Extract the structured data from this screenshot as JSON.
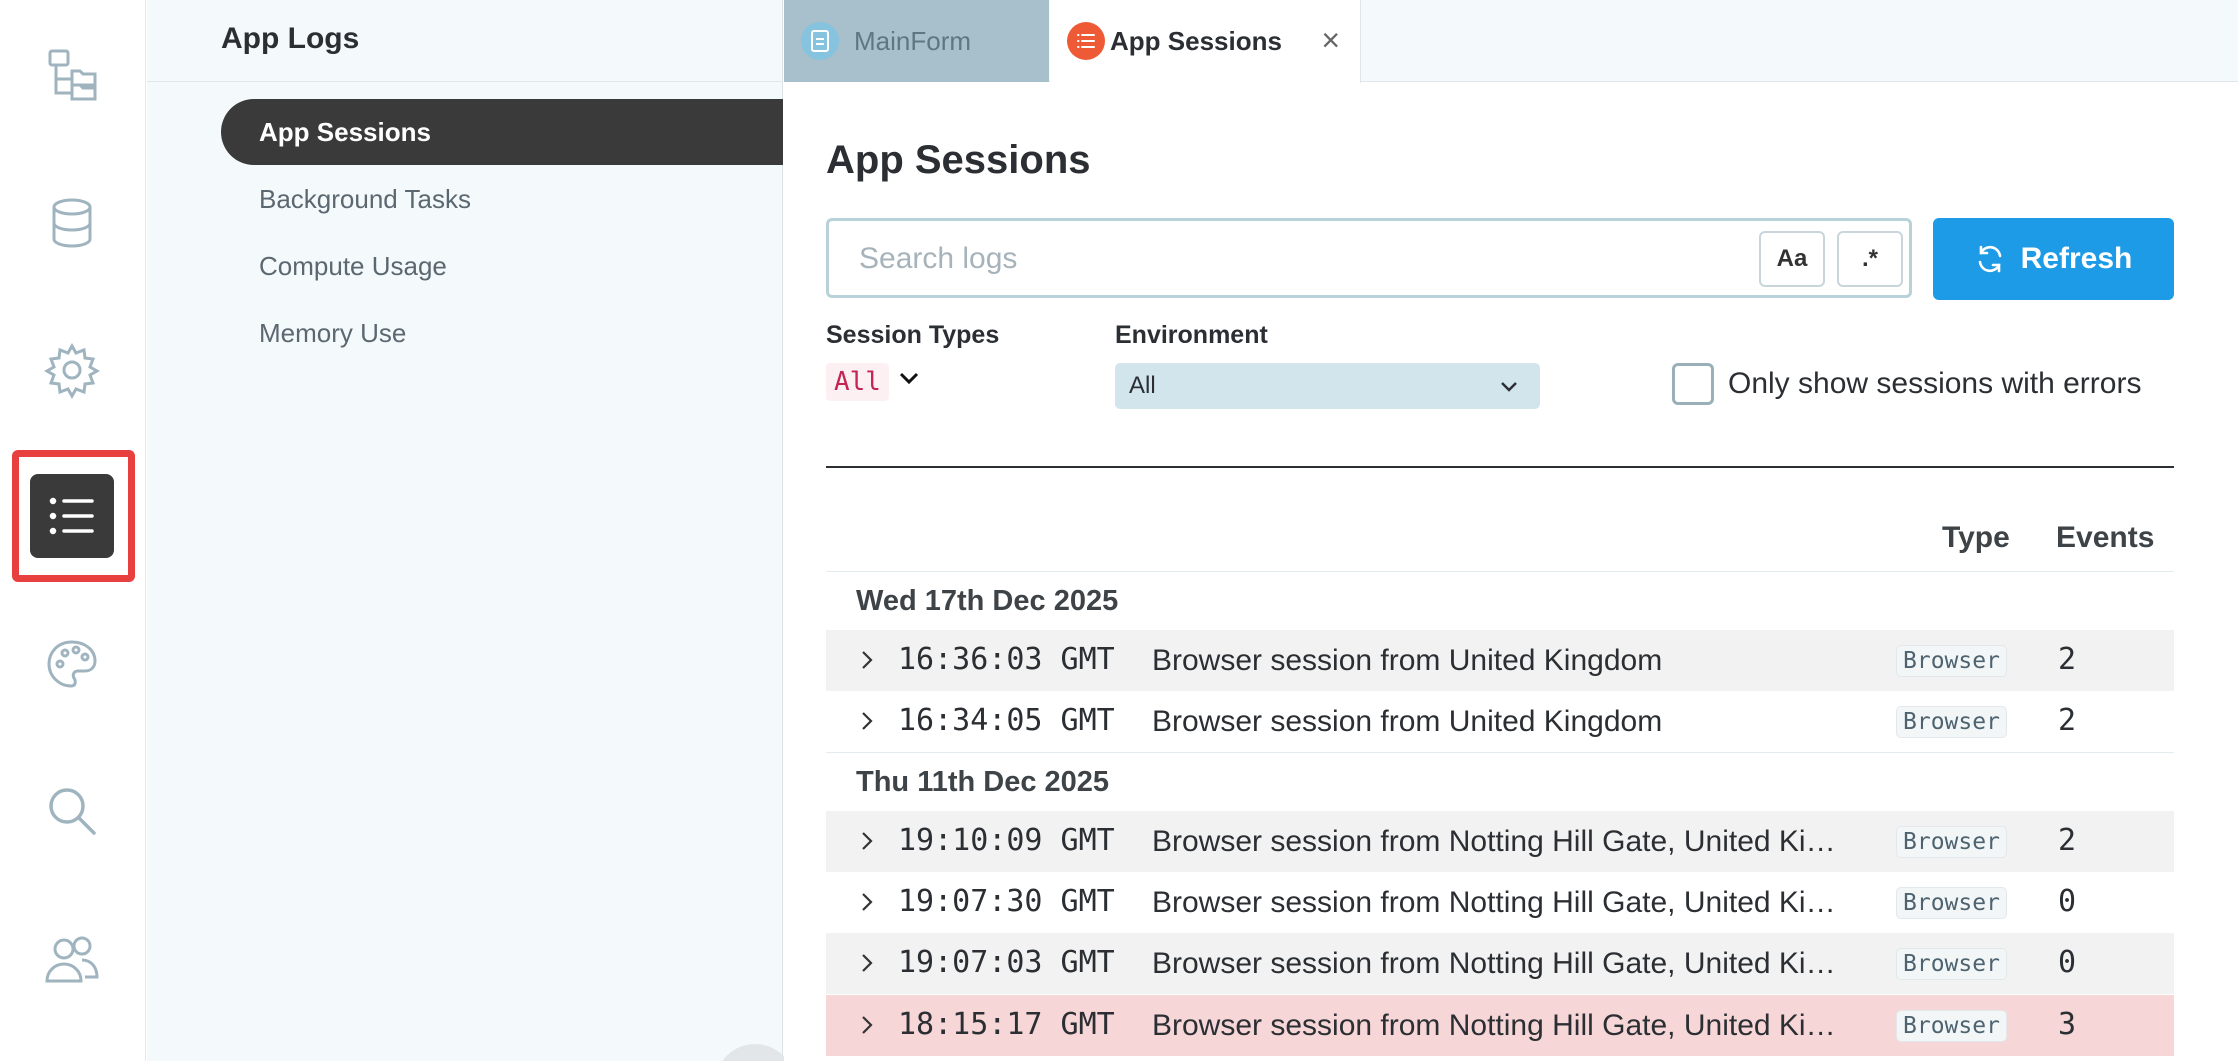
{
  "rail": {
    "items": [
      {
        "name": "tree-view-icon"
      },
      {
        "name": "database-icon"
      },
      {
        "name": "settings-gear-icon"
      },
      {
        "name": "list-icon",
        "active": true
      },
      {
        "name": "palette-icon"
      },
      {
        "name": "search-icon"
      },
      {
        "name": "users-icon"
      }
    ]
  },
  "panel": {
    "title": "App Logs",
    "items": [
      {
        "label": "App Sessions",
        "active": true
      },
      {
        "label": "Background Tasks"
      },
      {
        "label": "Compute Usage"
      },
      {
        "label": "Memory Use"
      }
    ]
  },
  "tabs": [
    {
      "label": "MainForm",
      "icon": "form-icon",
      "active": false
    },
    {
      "label": "App Sessions",
      "icon": "list-icon",
      "active": true,
      "close": "×"
    }
  ],
  "main": {
    "title": "App Sessions",
    "search": {
      "placeholder": "Search logs",
      "value": "",
      "case_toggle": "Aa",
      "regex_toggle": ".*"
    },
    "refresh_label": "Refresh",
    "filters": {
      "session_types_label": "Session Types",
      "session_types_value": "All",
      "environment_label": "Environment",
      "environment_value": "All",
      "errors_only_label": "Only show sessions with errors",
      "errors_only_checked": false
    },
    "columns": {
      "type": "Type",
      "events": "Events"
    },
    "groups": [
      {
        "date": "Wed 17th Dec 2025",
        "sessions": [
          {
            "time": "16:36:03 GMT",
            "desc": "Browser session from United Kingdom",
            "type": "Browser",
            "events": "2",
            "error": false
          },
          {
            "time": "16:34:05 GMT",
            "desc": "Browser session from United Kingdom",
            "type": "Browser",
            "events": "2",
            "error": false
          }
        ]
      },
      {
        "date": "Thu 11th Dec 2025",
        "sessions": [
          {
            "time": "19:10:09 GMT",
            "desc": "Browser session from Notting Hill Gate, United Kingdom",
            "type": "Browser",
            "events": "2",
            "error": false
          },
          {
            "time": "19:07:30 GMT",
            "desc": "Browser session from Notting Hill Gate, United Kingdom",
            "type": "Browser",
            "events": "0",
            "error": false
          },
          {
            "time": "19:07:03 GMT",
            "desc": "Browser session from Notting Hill Gate, United Kingdom",
            "type": "Browser",
            "events": "0",
            "error": false
          },
          {
            "time": "18:15:17 GMT",
            "desc": "Browser session from Notting Hill Gate, United Kingdom",
            "type": "Browser",
            "events": "3",
            "error": true
          }
        ]
      }
    ]
  },
  "colors": {
    "accent": "#1e9be6",
    "error_row": "#f6d6d7",
    "highlight": "#e8403f",
    "active_nav": "#3a3a3a"
  }
}
